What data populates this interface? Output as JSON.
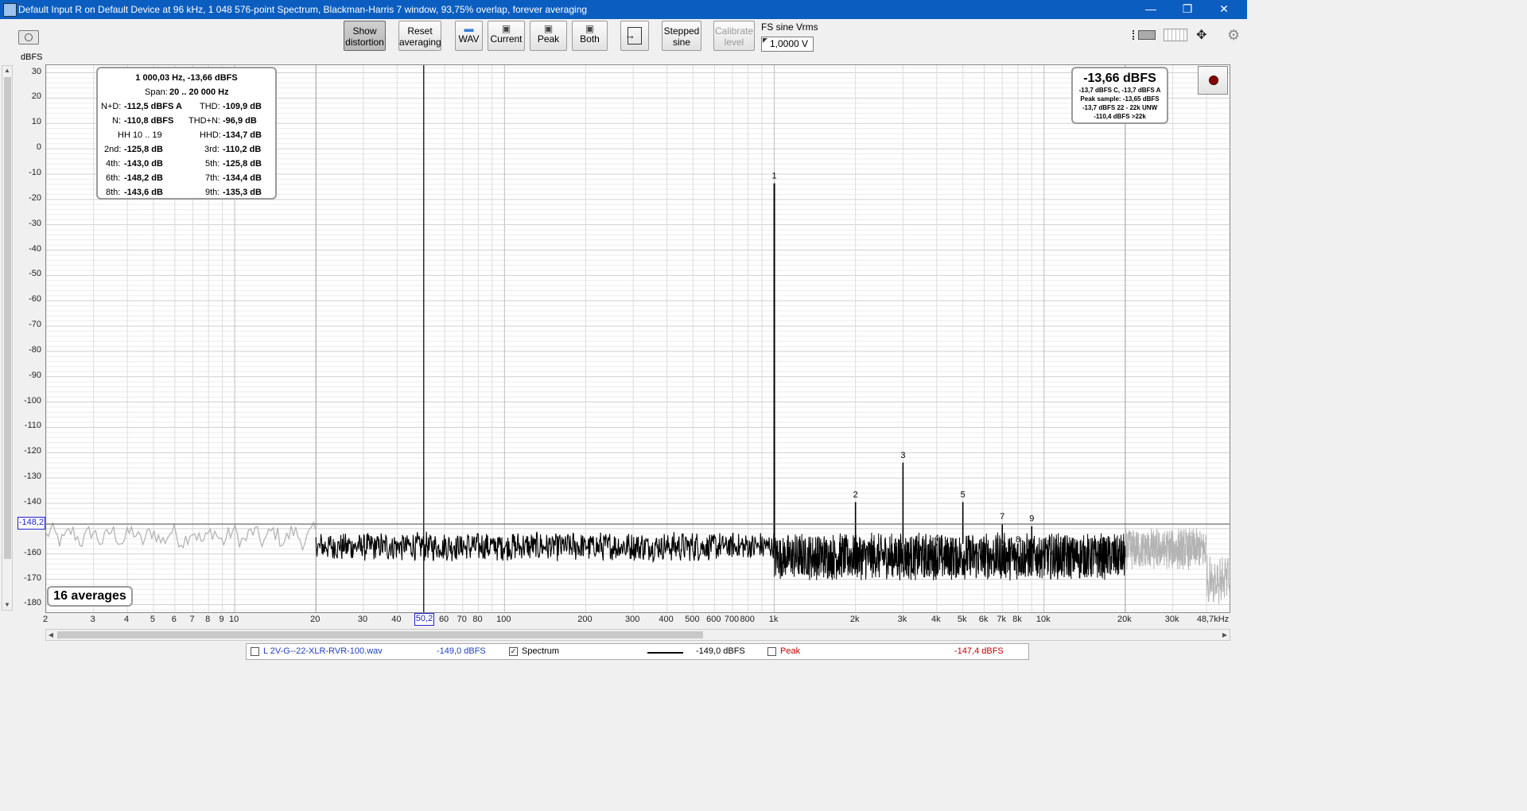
{
  "window": {
    "title": "Default Input R on Default Device at 96 kHz, 1 048 576-point Spectrum, Blackman-Harris 7 window, 93,75% overlap, forever averaging",
    "minimize": "—",
    "restore": "❐",
    "close": "✕"
  },
  "toolbar": {
    "show_distortion": [
      "Show",
      "distortion"
    ],
    "reset_averaging": [
      "Reset",
      "averaging"
    ],
    "wav": "WAV",
    "current": "Current",
    "peak": "Peak",
    "both": "Both",
    "stepped_sine": [
      "Stepped",
      "sine"
    ],
    "calibrate_level": [
      "Calibrate",
      "level"
    ],
    "fs_label": "FS sine Vrms",
    "fs_value": "1,0000 V"
  },
  "plot": {
    "y_unit": "dBFS",
    "y_ticks": [
      "30",
      "20",
      "10",
      "0",
      "-10",
      "-20",
      "-30",
      "-40",
      "-50",
      "-60",
      "-70",
      "-80",
      "-90",
      "-100",
      "-110",
      "-120",
      "-130",
      "-140",
      "-150",
      "-160",
      "-170",
      "-180"
    ],
    "x_ticks": [
      "2",
      "3",
      "4",
      "5",
      "6",
      "7",
      "8",
      "9",
      "10",
      "20",
      "30",
      "40",
      "60",
      "70",
      "80",
      "100",
      "200",
      "300",
      "400",
      "500",
      "600",
      "700",
      "800",
      "1k",
      "2k",
      "3k",
      "4k",
      "5k",
      "6k",
      "7k",
      "8k",
      "10k",
      "20k",
      "30k",
      "48,7kHz"
    ],
    "cursor_x": "50,2",
    "cursor_y": "-148,2",
    "averages": "16 averages"
  },
  "info": {
    "header": "1 000,03 Hz, -13,66 dBFS",
    "span_label": "Span:",
    "span_value": "20 .. 20 000 Hz",
    "nd_label": "N+D:",
    "nd_value": "-112,5 dBFS A",
    "thd_label": "THD:",
    "thd_value": "-109,9 dB",
    "n_label": "N:",
    "n_value": "-110,8 dBFS",
    "thdn_label": "THD+N:",
    "thdn_value": "-96,9 dB",
    "hh_label": "HH 10 .. 19",
    "hhd_label": "HHD:",
    "hhd_value": "-134,7 dB",
    "h2_label": "2nd:",
    "h2_value": "-125,8 dB",
    "h3_label": "3rd:",
    "h3_value": "-110,2 dB",
    "h4_label": "4th:",
    "h4_value": "-143,0 dB",
    "h5_label": "5th:",
    "h5_value": "-125,8 dB",
    "h6_label": "6th:",
    "h6_value": "-148,2 dB",
    "h7_label": "7th:",
    "h7_value": "-134,4 dB",
    "h8_label": "8th:",
    "h8_value": "-143,6 dB",
    "h9_label": "9th:",
    "h9_value": "-135,3 dB"
  },
  "level": {
    "main": "-13,66 dBFS",
    "line1": "-13,7 dBFS C, -13,7 dBFS A",
    "line2": "Peak sample: -13,65 dBFS",
    "line3": "-13,7 dBFS 22 - 22k UNW",
    "line4": "-110,4 dBFS >22k"
  },
  "legend": {
    "file_name": "L 2V-G--22-XLR-RVR-100.wav",
    "file_level": "-149,0 dBFS",
    "spectrum_label": "Spectrum",
    "spectrum_level": "-149,0 dBFS",
    "peak_label": "Peak",
    "peak_level": "-147,4 dBFS"
  },
  "colors": {
    "title_bar": "#0b5ec0",
    "trace": "#000000",
    "trace_out_of_span": "#b4b4b4",
    "file_text": "#2040c0",
    "peak_text": "#c00000"
  },
  "chart_data": {
    "type": "line",
    "x_scale": "log",
    "xlim": [
      2,
      48700
    ],
    "ylim": [
      -183,
      33
    ],
    "ylabel": "dBFS",
    "cursor": {
      "x": 50.2,
      "y": -148.2
    },
    "harmonics": [
      {
        "n": 1,
        "freq": 1000,
        "level": -13.66
      },
      {
        "n": 2,
        "freq": 2000,
        "level": -139.5
      },
      {
        "n": 3,
        "freq": 3000,
        "level": -123.9
      },
      {
        "n": 4,
        "freq": 4000,
        "level": -156.7
      },
      {
        "n": 5,
        "freq": 5000,
        "level": -139.5
      },
      {
        "n": 6,
        "freq": 6000,
        "level": -161.9
      },
      {
        "n": 7,
        "freq": 7000,
        "level": -148.1
      },
      {
        "n": 8,
        "freq": 8000,
        "level": -157.3
      },
      {
        "n": 9,
        "freq": 9000,
        "level": -149.0
      }
    ],
    "noise_floor_db": -159
  }
}
